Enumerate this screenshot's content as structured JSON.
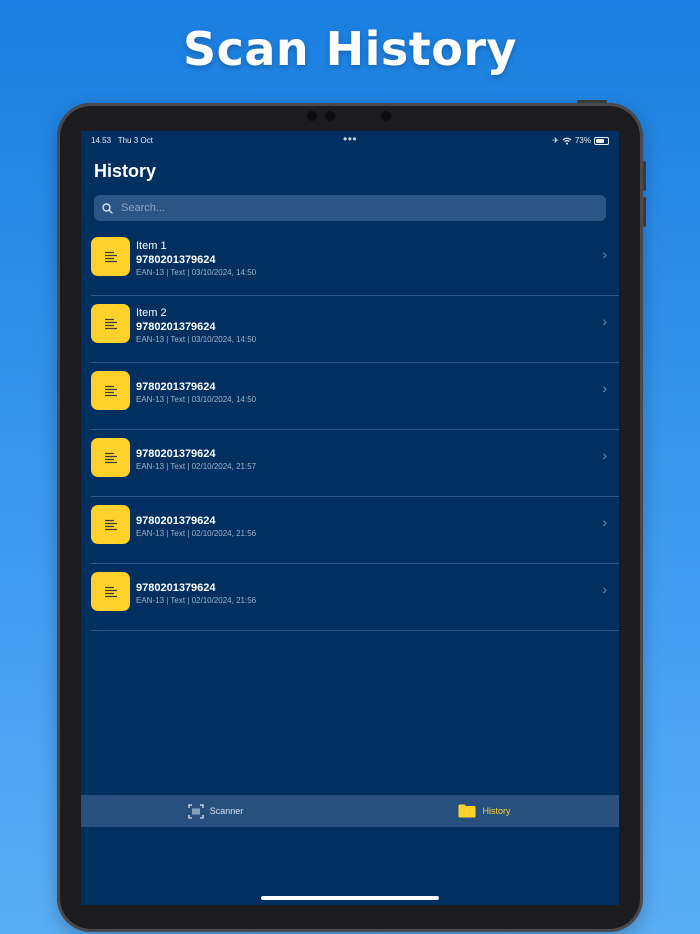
{
  "headline": "Scan History",
  "status_bar": {
    "time": "14.53",
    "date": "Thu 3 Oct",
    "battery": "73%"
  },
  "screen_title": "History",
  "search": {
    "placeholder": "Search..."
  },
  "items": [
    {
      "name": "Item 1",
      "code": "9780201379624",
      "meta": "EAN-13 | Text | 03/10/2024, 14:50"
    },
    {
      "name": "Item 2",
      "code": "9780201379624",
      "meta": "EAN-13 | Text | 03/10/2024, 14:50"
    },
    {
      "name": "",
      "code": "9780201379624",
      "meta": "EAN-13 | Text | 03/10/2024, 14:50"
    },
    {
      "name": "",
      "code": "9780201379624",
      "meta": "EAN-13 | Text | 02/10/2024, 21:57"
    },
    {
      "name": "",
      "code": "9780201379624",
      "meta": "EAN-13 | Text | 02/10/2024, 21:56"
    },
    {
      "name": "",
      "code": "9780201379624",
      "meta": "EAN-13 | Text | 02/10/2024, 21:56"
    }
  ],
  "tabs": [
    {
      "label": "Scanner",
      "icon": "barcode-scan-icon"
    },
    {
      "label": "History",
      "icon": "folder-icon",
      "active": true
    }
  ],
  "colors": {
    "background": "#013060",
    "accent": "#ffd12a",
    "tabbar": "#28507f"
  }
}
